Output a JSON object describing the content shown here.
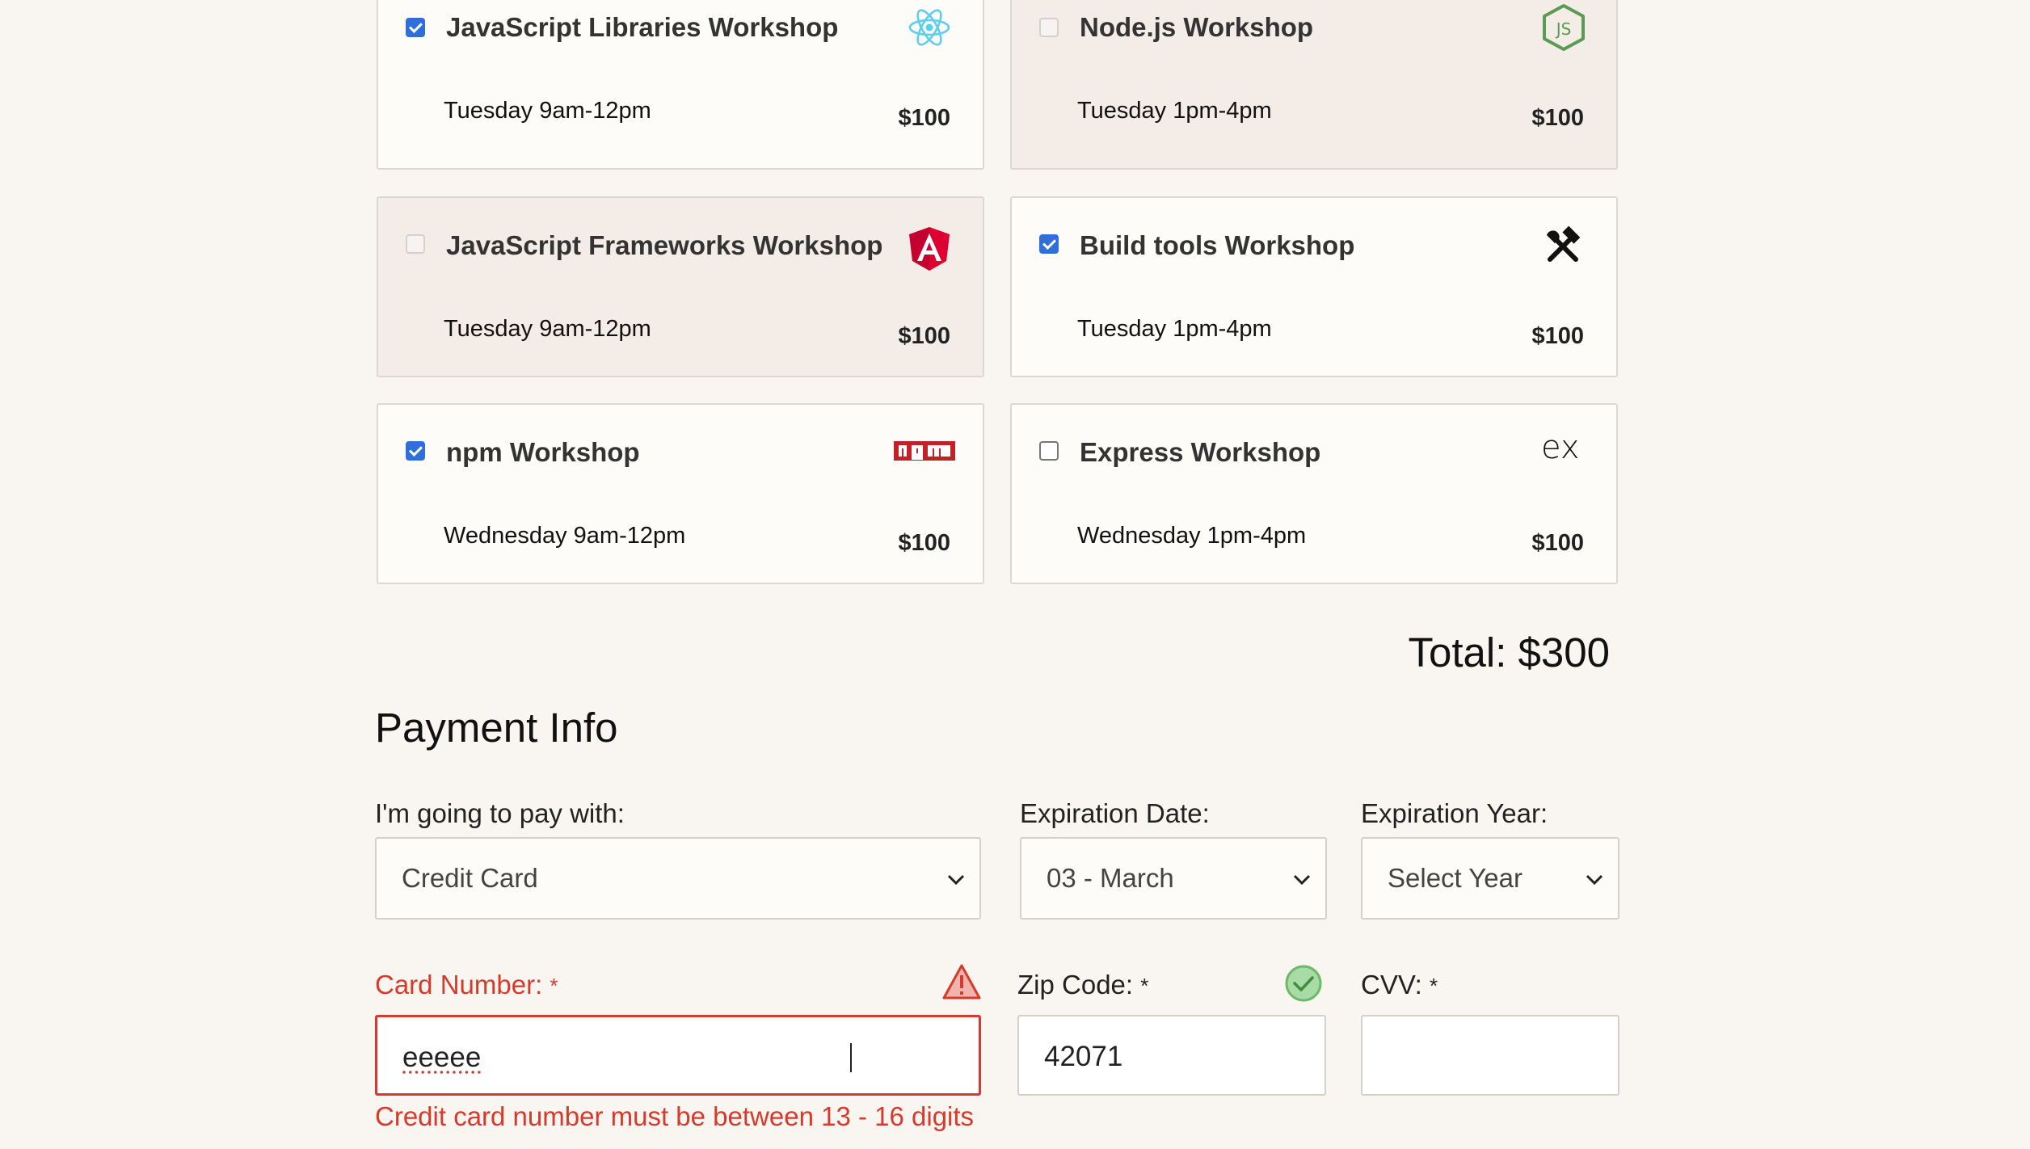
{
  "workshops": [
    {
      "title": "JavaScript Libraries Workshop",
      "time": "Tuesday 9am-12pm",
      "price": "$100",
      "checked": true,
      "disabled": false,
      "icon": "react-icon"
    },
    {
      "title": "Node.js Workshop",
      "time": "Tuesday 1pm-4pm",
      "price": "$100",
      "checked": false,
      "disabled": true,
      "icon": "nodejs-icon"
    },
    {
      "title": "JavaScript Frameworks Workshop",
      "time": "Tuesday 9am-12pm",
      "price": "$100",
      "checked": false,
      "disabled": true,
      "icon": "angular-icon"
    },
    {
      "title": "Build tools Workshop",
      "time": "Tuesday 1pm-4pm",
      "price": "$100",
      "checked": true,
      "disabled": false,
      "icon": "tools-icon"
    },
    {
      "title": "npm Workshop",
      "time": "Wednesday 9am-12pm",
      "price": "$100",
      "checked": true,
      "disabled": false,
      "icon": "npm-icon"
    },
    {
      "title": "Express Workshop",
      "time": "Wednesday 1pm-4pm",
      "price": "$100",
      "checked": false,
      "disabled": false,
      "icon": "express-icon"
    }
  ],
  "total": "Total: $300",
  "payment": {
    "heading": "Payment Info",
    "pay_with_label": "I'm going to pay with:",
    "pay_with_value": "Credit Card",
    "exp_date_label": "Expiration Date:",
    "exp_date_value": "03 - March",
    "exp_year_label": "Expiration Year:",
    "exp_year_value": "Select Year",
    "card_number_label": "Card Number:",
    "card_number_value": "eeeee",
    "card_number_error": "Credit card number must be between 13 - 16 digits",
    "zip_label": "Zip Code:",
    "zip_value": "42071",
    "cvv_label": "CVV:",
    "cvv_value": "",
    "required_mark": "*"
  },
  "colors": {
    "error": "#d63a2b",
    "checkbox": "#2f6fdc",
    "valid": "#7cc47a"
  }
}
